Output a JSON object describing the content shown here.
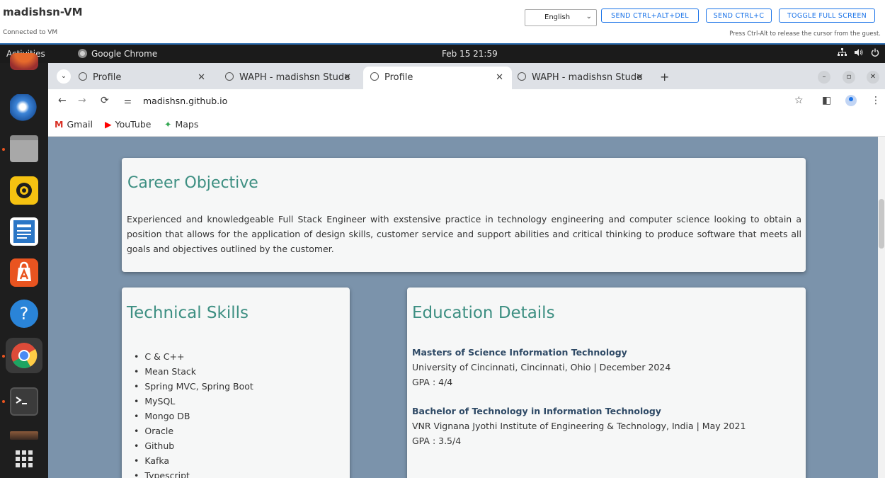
{
  "vm": {
    "title": "madishsn-VM",
    "status": "Connected to VM",
    "language": "English",
    "buttons": [
      "SEND CTRL+ALT+DEL",
      "SEND CTRL+C",
      "TOGGLE FULL SCREEN"
    ],
    "hint": "Press Ctrl-Alt to release the cursor from the guest."
  },
  "topbar": {
    "activities": "Activities",
    "app": "Google Chrome",
    "clock": "Feb 15 21:59",
    "icons": [
      "network-icon",
      "volume-icon",
      "power-icon"
    ]
  },
  "dock": {
    "apps": [
      "firefox-icon",
      "thunderbird-icon",
      "files-icon",
      "rhythmbox-icon",
      "writer-icon",
      "app-center-icon",
      "help-icon",
      "chrome-icon",
      "terminal-icon",
      "trash-icon",
      "show-apps-icon"
    ]
  },
  "browser": {
    "tabs": [
      {
        "title": "Profile"
      },
      {
        "title": "WAPH - madishsn Stude"
      },
      {
        "title": "Profile"
      },
      {
        "title": "WAPH - madishsn Stude"
      }
    ],
    "url": "madishsn.github.io",
    "bookmarks": [
      "Gmail",
      "YouTube",
      "Maps"
    ]
  },
  "page": {
    "career": {
      "title": "Career Objective",
      "text": "Experienced and knowledgeable Full Stack Engineer with exstensive practice in technology engineering and computer science looking to obtain a position that allows for the application of design skills, customer service and support abilities and critical thinking to produce software that meets all goals and objectives outlined by the customer."
    },
    "skills": {
      "title": "Technical Skills",
      "items": [
        "C & C++",
        "Mean Stack",
        "Spring MVC, Spring Boot",
        "MySQL",
        "Mongo DB",
        "Oracle",
        "Github",
        "Kafka",
        "Typescript"
      ]
    },
    "education": {
      "title": "Education Details",
      "entries": [
        {
          "degree": "Masters of Science Information Technology",
          "school": "University of Cincinnati, Cincinnati, Ohio | December 2024",
          "gpa": "GPA : 4/4"
        },
        {
          "degree": "Bachelor of Technology in Information Technology",
          "school": "VNR Vignana Jyothi Institute of Engineering & Technology, India | May 2021",
          "gpa": "GPA : 3.5/4"
        }
      ]
    }
  },
  "colors": {
    "page_background": "#7b93ab",
    "heading": "#3d8f82",
    "degree": "#2f4a66",
    "vm_accent": "#1a73e8",
    "ubuntu_orange": "#e95420"
  }
}
